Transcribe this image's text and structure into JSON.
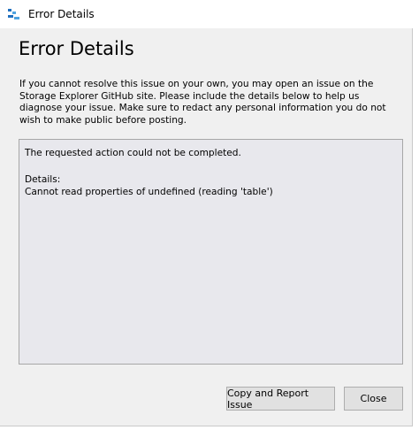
{
  "window": {
    "title": "Error Details",
    "icon": "storage-explorer-icon"
  },
  "dialog": {
    "heading": "Error Details",
    "description": "If you cannot resolve this issue on your own, you may open an issue on the Storage Explorer GitHub site. Please include the details below to help us diagnose your issue. Make sure to redact any personal information you do not wish to make public before posting.",
    "details": {
      "summary": "The requested action could not be completed.",
      "label": "Details:",
      "message": "Cannot read properties of undefined (reading 'table')"
    }
  },
  "buttons": {
    "copy_report": "Copy and Report Issue",
    "close": "Close"
  },
  "colors": {
    "dialog_bg": "#f0f0f0",
    "details_bg": "#e8e8ed",
    "button_bg": "#e1e1e1",
    "accent": "#1f6fbf"
  }
}
